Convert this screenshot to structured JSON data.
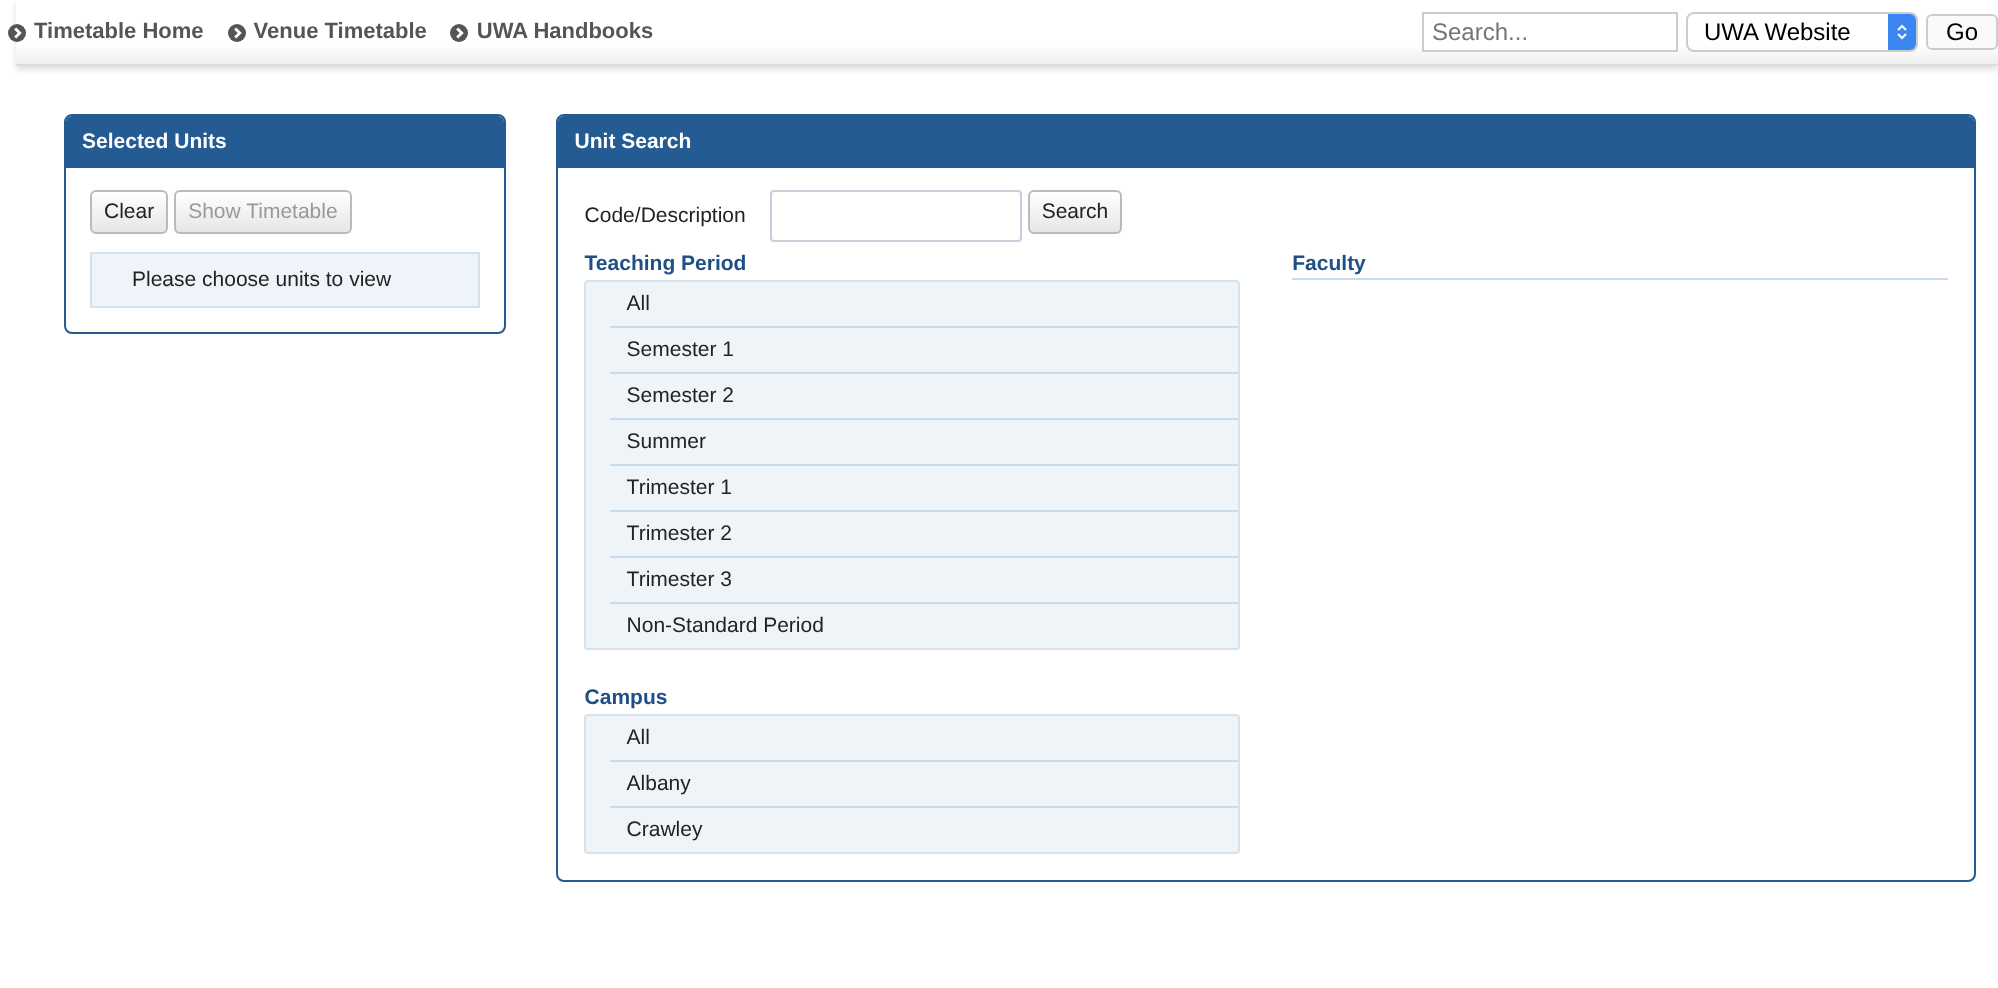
{
  "nav_links": [
    "Timetable Home",
    "Venue Timetable",
    "UWA Handbooks"
  ],
  "site_search": {
    "placeholder": "Search...",
    "scope": "UWA Website",
    "go": "Go"
  },
  "selected_units": {
    "title": "Selected Units",
    "buttons": [
      {
        "label": "Clear",
        "disabled": false
      },
      {
        "label": "Show Timetable",
        "disabled": true
      }
    ],
    "message": "Please choose units to view"
  },
  "unit_search": {
    "title": "Unit Search",
    "code_label": "Code/Description",
    "search_button": "Search",
    "teaching_period": {
      "title": "Teaching Period",
      "items": [
        "All",
        "Semester 1",
        "Semester 2",
        "Summer",
        "Trimester 1",
        "Trimester 2",
        "Trimester 3",
        "Non-Standard Period"
      ]
    },
    "campus": {
      "title": "Campus",
      "items": [
        "All",
        "Albany",
        "Crawley"
      ]
    },
    "faculty": {
      "title": "Faculty"
    }
  }
}
